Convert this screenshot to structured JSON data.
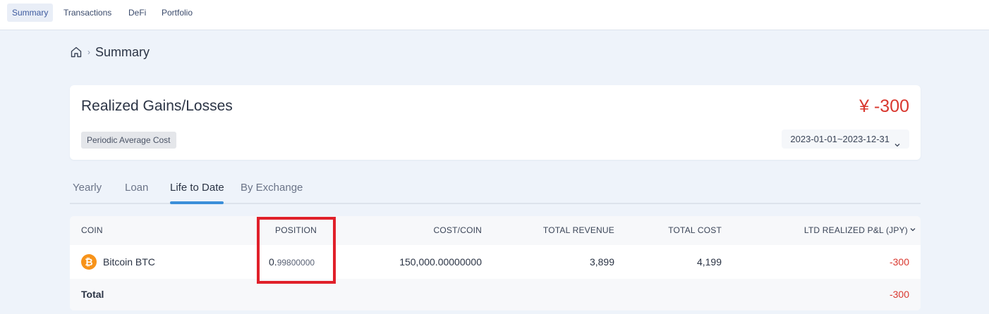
{
  "nav": {
    "tabs": [
      {
        "label": "Summary",
        "active": true
      },
      {
        "label": "Transactions",
        "active": false
      },
      {
        "label": "DeFi",
        "active": false
      },
      {
        "label": "Portfolio",
        "active": false
      }
    ]
  },
  "breadcrumb": {
    "separator": "›",
    "title": "Summary"
  },
  "summary": {
    "title": "Realized Gains/Losses",
    "method": "Periodic Average Cost",
    "total": "¥ -300",
    "date_range": "2023-01-01~2023-12-31"
  },
  "tabs": [
    {
      "label": "Yearly"
    },
    {
      "label": "Loan"
    },
    {
      "label": "Life to Date",
      "active": true
    },
    {
      "label": "By Exchange"
    }
  ],
  "table": {
    "headers": {
      "coin": "COIN",
      "position": "POSITION",
      "cost_per_coin": "COST/COIN",
      "total_revenue": "TOTAL REVENUE",
      "total_cost": "TOTAL COST",
      "ltd_pnl": "LTD REALIZED P&L (JPY)"
    },
    "rows": [
      {
        "coin_icon": "₿",
        "coin_name": "Bitcoin",
        "coin_symbol": "BTC",
        "position_major": "0.",
        "position_minor": "99800000",
        "cost_per_coin": "150,000.00000000",
        "total_revenue": "3,899",
        "total_cost": "4,199",
        "ltd_pnl": "-300"
      }
    ],
    "total": {
      "label": "Total",
      "ltd_pnl": "-300"
    }
  },
  "colors": {
    "accent": "#3b8fd9",
    "negative": "#d9382f",
    "highlight": "#e0202a",
    "btc": "#f7931a"
  }
}
